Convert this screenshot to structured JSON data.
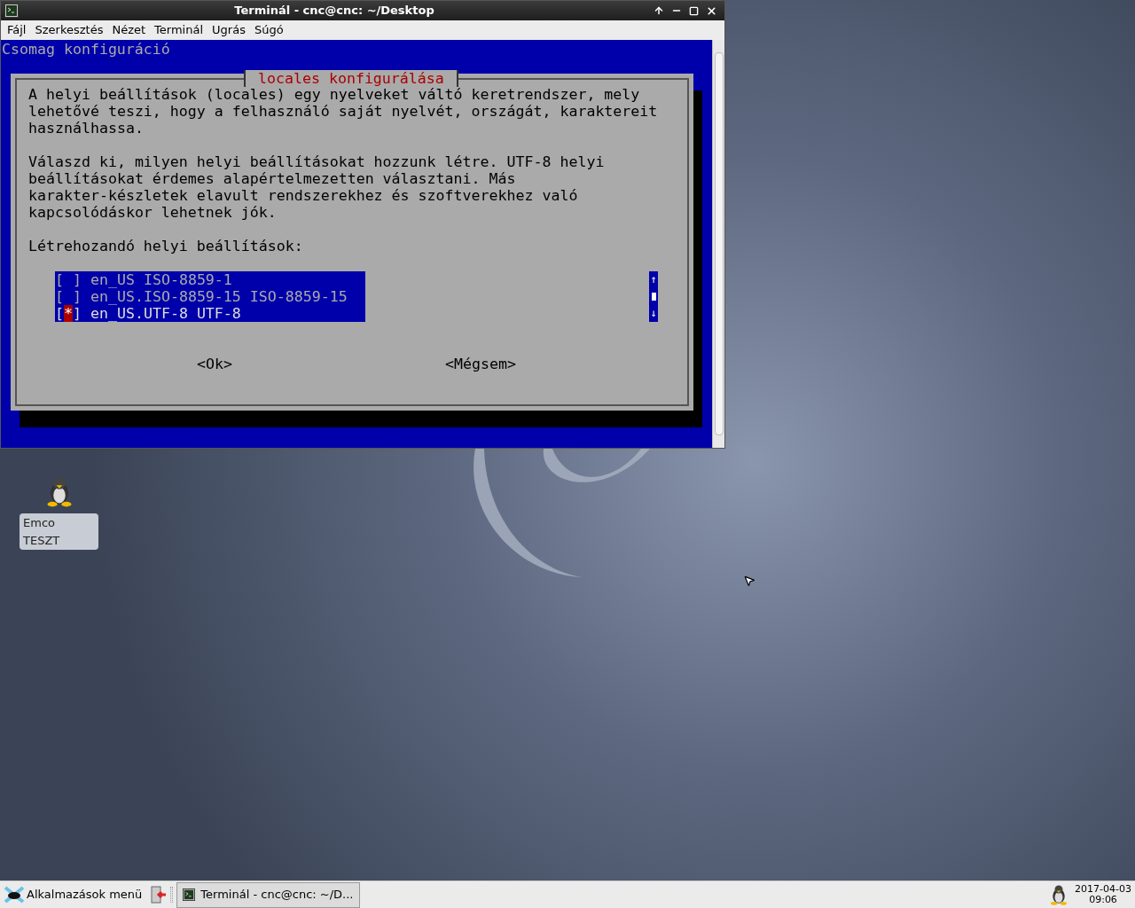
{
  "window": {
    "title": "Terminál - cnc@cnc: ~/Desktop"
  },
  "menu": [
    "Fájl",
    "Szerkesztés",
    "Nézet",
    "Terminál",
    "Ugrás",
    "Súgó"
  ],
  "terminal": {
    "header": "Csomag konfiguráció",
    "dialog": {
      "title": "locales konfigurálása",
      "paragraphs": [
        [
          "A helyi beállítások (locales) egy nyelveket váltó keretrendszer, mely",
          "lehetővé teszi, hogy a felhasználó saját nyelvét, országát, karaktereit",
          "használhassa."
        ],
        [
          "Válaszd ki, milyen helyi beállításokat hozzunk létre. UTF-8 helyi",
          "beállításokat érdemes alapértelmezetten választani. Más",
          "karakter-készletek elavult rendszerekhez és szoftverekhez való",
          "kapcsolódáskor lehetnek jók."
        ],
        [
          "Létrehozandó helyi beállítások:"
        ]
      ],
      "items": [
        {
          "box": "[ ]",
          "label": "en_US ISO-8859-1",
          "selected": false
        },
        {
          "box": "[ ]",
          "label": "en_US.ISO-8859-15 ISO-8859-15",
          "selected": false
        },
        {
          "box": "[*]",
          "label": "en_US.UTF-8 UTF-8",
          "selected": true
        }
      ],
      "scroll_up": "↑",
      "scroll_down": "↓",
      "buttons": [
        "<Ok>",
        "<Mégsem>"
      ]
    }
  },
  "desktop_icons": [
    {
      "label": "Emco TESZT"
    }
  ],
  "taskbar": {
    "menu_button": "Alkalmazások menü",
    "tasks": [
      {
        "label": "Terminál - cnc@cnc: ~/D...",
        "selected": true
      }
    ],
    "date": "2017-04-03",
    "time": "09:06"
  }
}
